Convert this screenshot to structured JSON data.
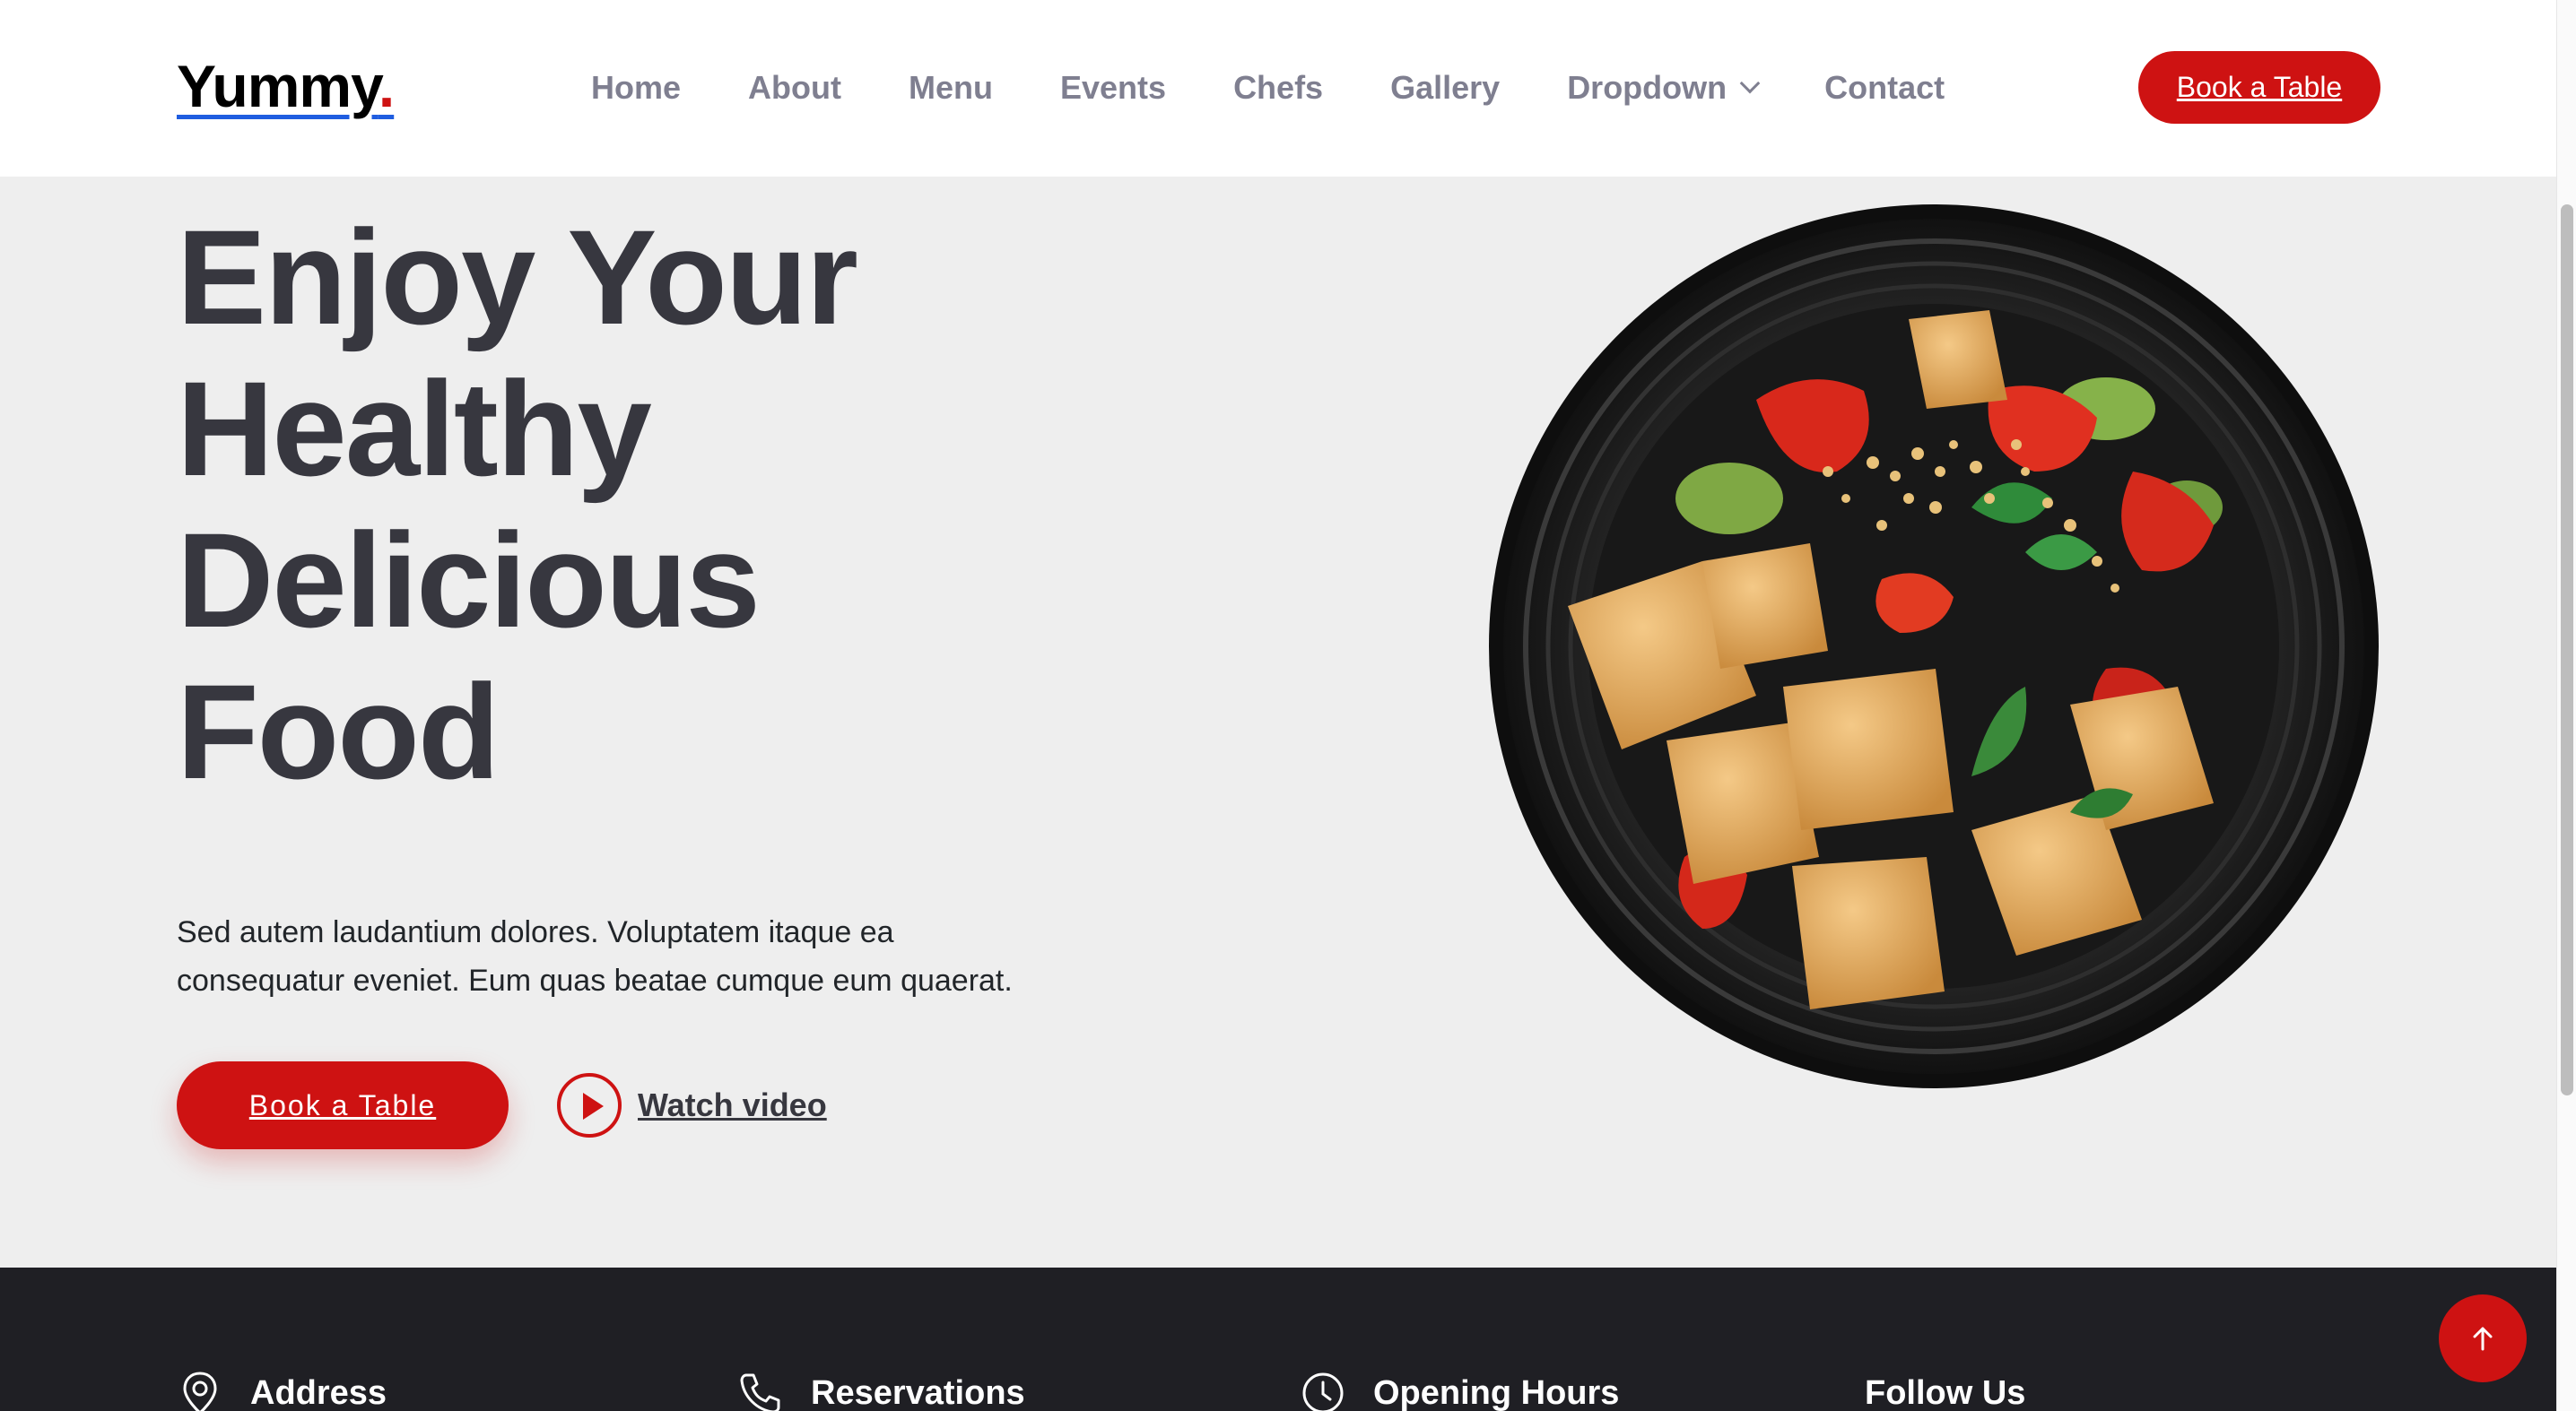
{
  "brand": {
    "name": "Yummy",
    "dot": "."
  },
  "nav": {
    "items": [
      "Home",
      "About",
      "Menu",
      "Events",
      "Chefs",
      "Gallery",
      "Dropdown",
      "Contact"
    ],
    "dropdown_icon": "chevron-down-icon"
  },
  "header": {
    "cta_label": "Book a Table"
  },
  "hero": {
    "title_lines": [
      "Enjoy Your",
      "Healthy",
      "Delicious",
      "Food"
    ],
    "text_lines": [
      "Sed autem laudantium dolores. Voluptatem itaque ea",
      "consequatur eveniet. Eum quas beatae cumque eum quaerat."
    ],
    "cta_label": "Book a Table",
    "video_label": "Watch video",
    "video_icon": "play-circle-icon",
    "image": "dish-image"
  },
  "footer": {
    "columns": [
      {
        "title": "Address",
        "icon": "map-pin-icon"
      },
      {
        "title": "Reservations",
        "icon": "phone-icon"
      },
      {
        "title": "Opening Hours",
        "icon": "clock-icon"
      },
      {
        "title": "Follow Us",
        "icon": ""
      }
    ]
  },
  "back_to_top": {
    "icon": "arrow-up-icon"
  },
  "colors": {
    "accent": "#ce1212",
    "heading": "#37373f",
    "nav_text": "#7f7f90",
    "hero_bg": "#eeeeee",
    "footer_bg": "#1f1f24",
    "logo_underline": "#1f5de0"
  }
}
